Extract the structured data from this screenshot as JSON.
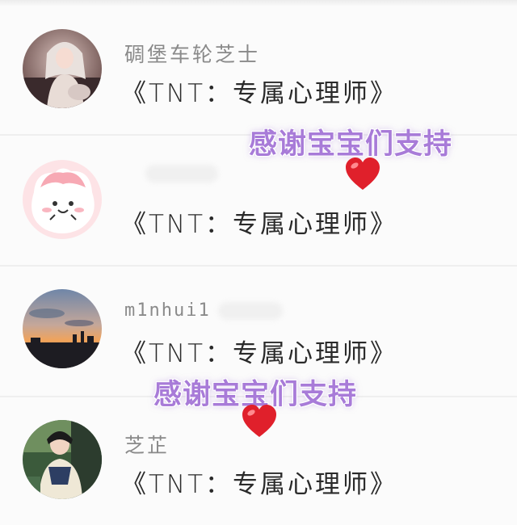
{
  "comments": [
    {
      "username": "碉堡车轮芝士",
      "text": "《TNT：专属心理师》",
      "avatar": "avatar-photo-girl-icon"
    },
    {
      "username": "",
      "text": "《TNT：专属心理师》",
      "avatar": "avatar-cartoon-pink-icon"
    },
    {
      "username": "m1nhui1",
      "text": "《TNT：专属心理师》",
      "avatar": "avatar-sunset-city-icon"
    },
    {
      "username": "芝芷",
      "text": "《TNT：专属心理师》",
      "avatar": "avatar-photo-hanfu-icon"
    }
  ],
  "stickers": [
    {
      "text": "感谢宝宝们支持",
      "icon": "heart-icon"
    },
    {
      "text": "感谢宝宝们支持",
      "icon": "heart-icon"
    }
  ],
  "colors": {
    "sticker": "#a87bd8",
    "heart": "#e0202b"
  }
}
